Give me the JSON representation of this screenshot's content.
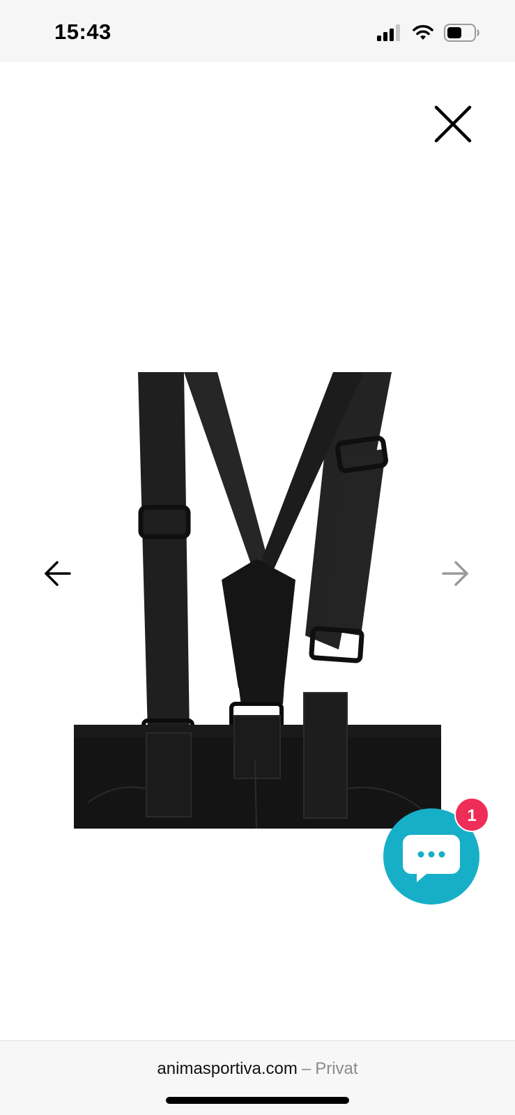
{
  "status_bar": {
    "time": "15:43",
    "icons": [
      "signal-icon",
      "wifi-icon",
      "battery-icon"
    ]
  },
  "viewer": {
    "close_icon": "close-icon",
    "prev_icon": "arrow-left-icon",
    "next_icon": "arrow-right-icon",
    "image_subject": "black ski trousers suspenders"
  },
  "chat": {
    "icon": "chat-bubble-icon",
    "badge_count": "1",
    "accent": "#17afc7",
    "badge_color": "#ee2d58"
  },
  "address_bar": {
    "domain": "animasportiva.com",
    "separator": "–",
    "mode": "Privat"
  }
}
